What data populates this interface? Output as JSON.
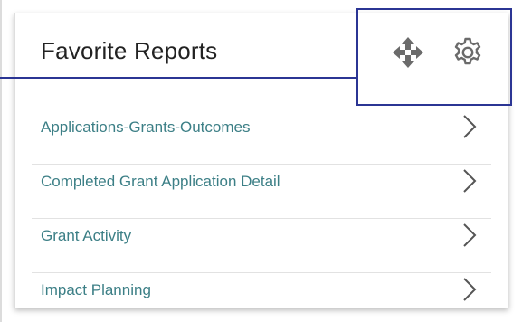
{
  "widget": {
    "title": "Favorite Reports",
    "icons": {
      "move": "move-arrows-icon",
      "settings": "gear-icon"
    }
  },
  "reports": [
    {
      "label": "Applications-Grants-Outcomes"
    },
    {
      "label": "Completed Grant Application Detail"
    },
    {
      "label": "Grant Activity"
    },
    {
      "label": "Impact Planning"
    }
  ],
  "colors": {
    "title": "#222222",
    "link": "#3c7f86",
    "icon": "#6b6b6b",
    "annotation": "#2b3594",
    "divider": "#e2e2e2"
  }
}
